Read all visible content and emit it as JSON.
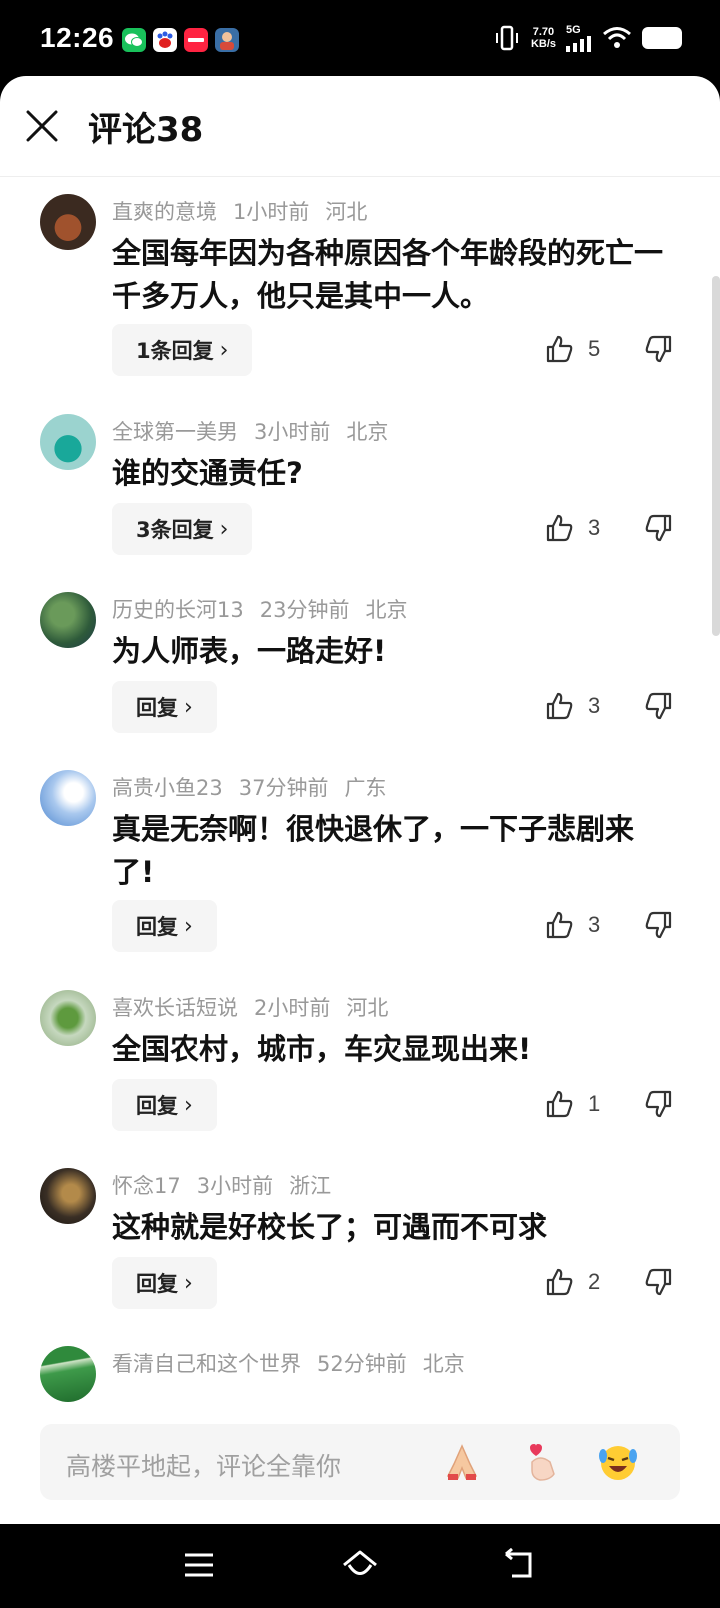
{
  "status_bar": {
    "time": "12:26",
    "net_speed_value": "7.70",
    "net_speed_unit": "KB/s",
    "net_type": "5G",
    "app_icons": [
      "wechat-icon",
      "baidu-icon",
      "xiaohongshu-icon",
      "game-icon"
    ]
  },
  "header": {
    "title": "评论38",
    "close_icon": "close-icon"
  },
  "comments": [
    {
      "user": "直爽的意境",
      "time": "1小时前",
      "location": "河北",
      "text": "全国每年因为各种原因各个年龄段的死亡一千多万人，他只是其中一人。",
      "reply": "1条回复",
      "likes": "5"
    },
    {
      "user": "全球第一美男",
      "time": "3小时前",
      "location": "北京",
      "text": "谁的交通责任?",
      "reply": "3条回复",
      "likes": "3"
    },
    {
      "user": "历史的长河13",
      "time": "23分钟前",
      "location": "北京",
      "text": "为人师表，一路走好!",
      "reply": "回复",
      "likes": "3"
    },
    {
      "user": "高贵小鱼23",
      "time": "37分钟前",
      "location": "广东",
      "text": "真是无奈啊！很快退休了，一下子悲剧来了!",
      "reply": "回复",
      "likes": "3"
    },
    {
      "user": "喜欢长话短说",
      "time": "2小时前",
      "location": "河北",
      "text": "全国农村，城市，车灾显现出来!",
      "reply": "回复",
      "likes": "1"
    },
    {
      "user": "怀念17",
      "time": "3小时前",
      "location": "浙江",
      "text": "这种就是好校长了；可遇而不可求",
      "reply": "回复",
      "likes": "2"
    },
    {
      "user": "看清自己和这个世界",
      "time": "52分钟前",
      "location": "北京"
    }
  ],
  "input": {
    "placeholder": "高楼平地起，评论全靠你",
    "emojis": [
      "pray-emoji",
      "finger-heart-emoji",
      "laughing-tears-emoji"
    ]
  },
  "nav": {
    "icons": [
      "menu-icon",
      "home-icon",
      "back-icon"
    ]
  },
  "colors": {
    "meta": "#999999",
    "text": "#111111",
    "reply_bg": "#f5f5f5"
  }
}
